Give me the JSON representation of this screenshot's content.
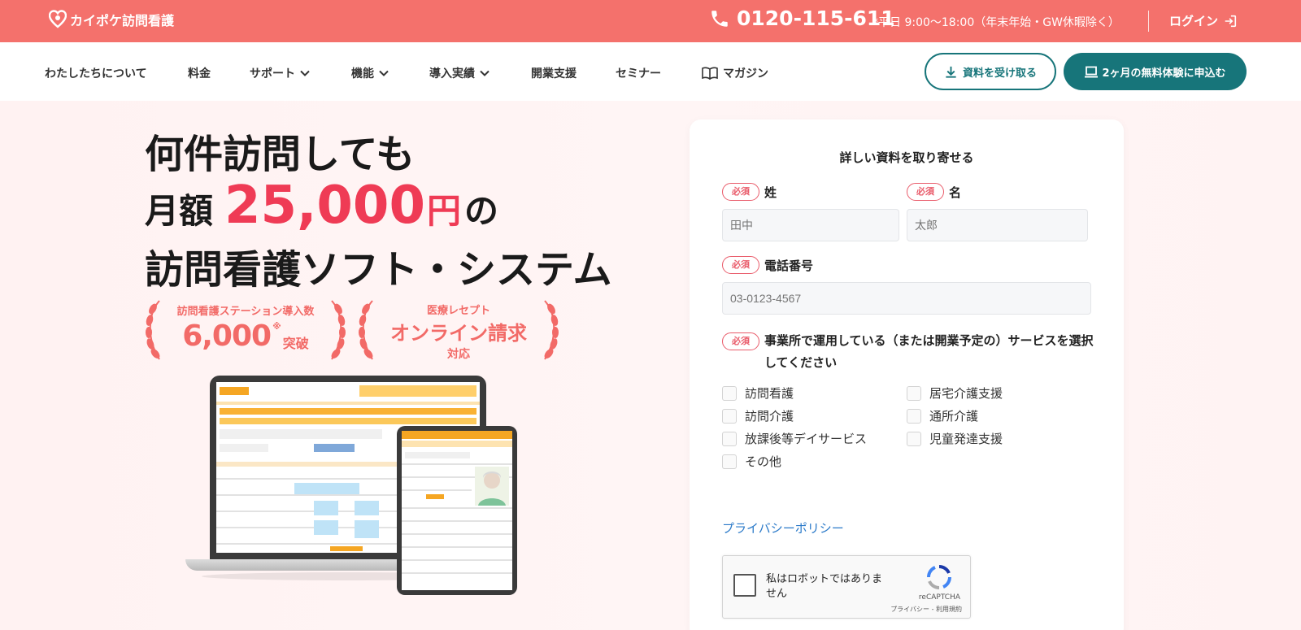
{
  "topbar": {
    "brand": "カイポケ訪問看護",
    "phone": "0120-115-611",
    "hours": "*平日 9:00〜18:00（年末年始・GW休暇除く）",
    "login": "ログイン"
  },
  "nav": {
    "items": [
      {
        "label": "わたしたちについて",
        "dropdown": false
      },
      {
        "label": "料金",
        "dropdown": false
      },
      {
        "label": "サポート",
        "dropdown": true
      },
      {
        "label": "機能",
        "dropdown": true
      },
      {
        "label": "導入実績",
        "dropdown": true
      },
      {
        "label": "開業支援",
        "dropdown": false
      },
      {
        "label": "セミナー",
        "dropdown": false
      },
      {
        "label": "マガジン",
        "dropdown": false,
        "icon": "book-icon"
      }
    ],
    "doc_button": "資料を受け取る",
    "trial_button": "2ヶ月の無料体験に申込む"
  },
  "hero": {
    "line1": "何件訪問しても",
    "line2_prefix": "月額",
    "price": "25,000",
    "yen": "円",
    "line2_suffix": "の",
    "line3": "訪問看護ソフト・システム",
    "award1": {
      "title": "訪問看護ステーション導入数",
      "number": "6,000",
      "note": "※",
      "suffix": "突破"
    },
    "award2": {
      "title": "医療レセプト",
      "main": "オンライン請求",
      "sub": "対応"
    }
  },
  "form": {
    "title": "詳しい資料を取り寄せる",
    "required_badge": "必須",
    "last_name_label": "姓",
    "last_name_placeholder": "田中",
    "first_name_label": "名",
    "first_name_placeholder": "太郎",
    "phone_label": "電話番号",
    "phone_placeholder": "03-0123-4567",
    "services_label": "事業所で運用している（または開業予定の）サービスを選択してください",
    "services": [
      "訪問看護",
      "居宅介護支援",
      "訪問介護",
      "通所介護",
      "放課後等デイサービス",
      "児童発達支援",
      "その他"
    ],
    "privacy_link": "プライバシーポリシー",
    "captcha": {
      "text": "私はロボットではありません",
      "brand": "reCAPTCHA",
      "terms": "プライバシー - 利用規約"
    }
  },
  "colors": {
    "topbar": "#f4716c",
    "accent_teal": "#17757a",
    "price_red": "#ef3b55",
    "award": "#f26a67",
    "required": "#e95b6a",
    "link": "#2b7ac9"
  }
}
